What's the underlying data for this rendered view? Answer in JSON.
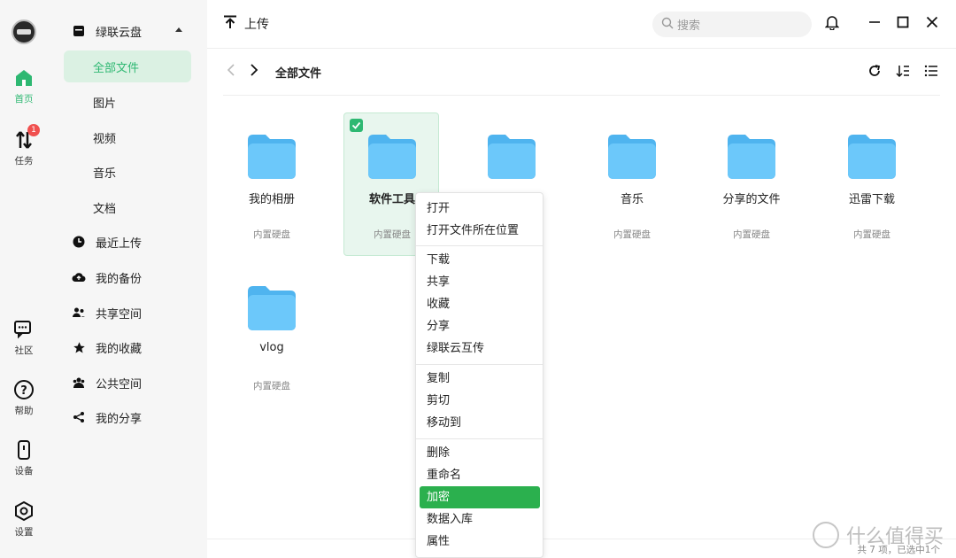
{
  "rail": {
    "items": [
      {
        "label": "首页",
        "icon": "home-icon"
      },
      {
        "label": "任务",
        "icon": "transfer-icon",
        "badge": "1"
      },
      {
        "label": "社区",
        "icon": "chat-icon"
      },
      {
        "label": "帮助",
        "icon": "help-icon"
      },
      {
        "label": "设备",
        "icon": "device-icon"
      },
      {
        "label": "设置",
        "icon": "settings-icon"
      }
    ]
  },
  "sidebar": {
    "header": "绿联云盘",
    "sub_items": [
      "全部文件",
      "图片",
      "视频",
      "音乐",
      "文档"
    ],
    "items": [
      "最近上传",
      "我的备份",
      "共享空间",
      "我的收藏",
      "公共空间",
      "我的分享"
    ]
  },
  "topbar": {
    "upload_label": "上传",
    "search_placeholder": "搜索"
  },
  "breadcrumb": {
    "current": "全部文件"
  },
  "files": [
    {
      "name": "我的相册",
      "location": "内置硬盘"
    },
    {
      "name": "软件工具",
      "location": "内置硬盘"
    },
    {
      "name": "",
      "location": ""
    },
    {
      "name": "音乐",
      "location": "内置硬盘"
    },
    {
      "name": "分享的文件",
      "location": "内置硬盘"
    },
    {
      "name": "迅雷下载",
      "location": "内置硬盘"
    },
    {
      "name": "vlog",
      "location": "内置硬盘"
    }
  ],
  "context_menu": {
    "items": [
      "打开",
      "打开文件所在位置",
      "下载",
      "共享",
      "收藏",
      "分享",
      "绿联云互传",
      "复制",
      "剪切",
      "移动到",
      "删除",
      "重命名",
      "加密",
      "数据入库",
      "属性"
    ],
    "highlighted": "加密"
  },
  "footer": {
    "status": "共 7 项，已选中1个"
  },
  "watermark": {
    "text": "什么值得买"
  },
  "colors": {
    "accent": "#2eb872",
    "folder": "#5cc1f6",
    "menu_highlight": "#2bb04e",
    "badge": "#f0504f"
  }
}
